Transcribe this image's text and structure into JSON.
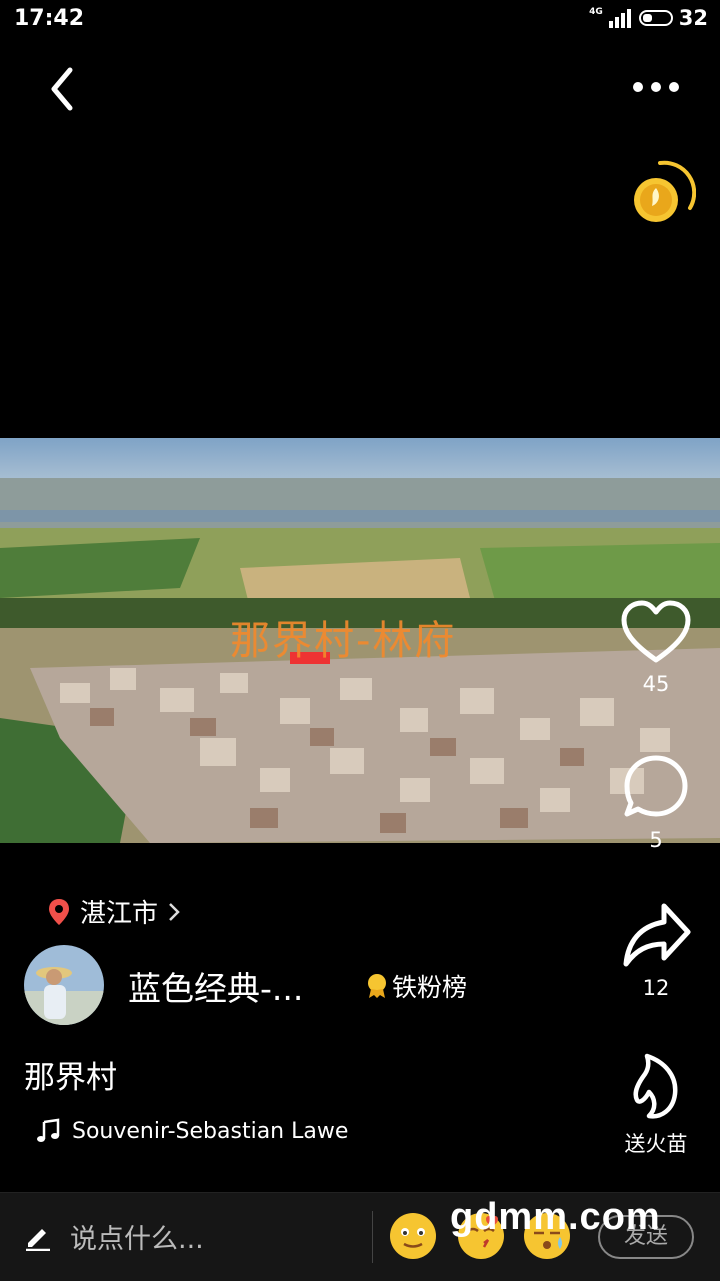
{
  "status_bar": {
    "time": "17:42",
    "network": "4G",
    "battery": "32"
  },
  "video": {
    "overlay_title": "那界村-林府"
  },
  "actions": {
    "likes": "45",
    "comments": "5",
    "shares": "12",
    "gift_label": "送火苗"
  },
  "location": {
    "label": "湛江市"
  },
  "author": {
    "name": "蓝色经典-...",
    "fan_badge": "铁粉榜"
  },
  "caption": "那界村",
  "music": {
    "title": "Souvenir-Sebastian Lawe"
  },
  "comment_bar": {
    "placeholder": "说点什么...",
    "send_label": "发送"
  },
  "watermark": "gdmm.com",
  "colors": {
    "accent_location": "#f0504a",
    "coin": "#f6c531",
    "overlay_text": "#f48a2c"
  }
}
